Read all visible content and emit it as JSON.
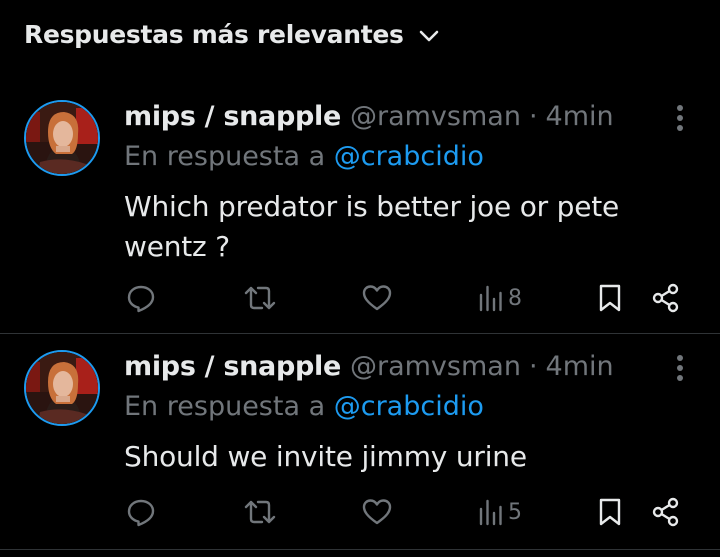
{
  "header": {
    "sort_label": "Respuestas más relevantes"
  },
  "replies": [
    {
      "display_name": "mips / snapple",
      "handle": "@ramvsman",
      "separator": "·",
      "time": "4min",
      "reply_prefix": "En respuesta a",
      "reply_to": "@crabcidio",
      "text": "Which predator is better joe or pete wentz ?",
      "views": "8"
    },
    {
      "display_name": "mips / snapple",
      "handle": "@ramvsman",
      "separator": "·",
      "time": "4min",
      "reply_prefix": "En respuesta a",
      "reply_to": "@crabcidio",
      "text": "Should we invite jimmy urine",
      "views": "5"
    }
  ],
  "icons": {
    "sort": "chevron-down-icon",
    "more": "more-vertical-icon",
    "reply": "reply-icon",
    "repost": "repost-icon",
    "like": "heart-icon",
    "views": "views-icon",
    "bookmark": "bookmark-icon",
    "share": "share-icon"
  },
  "colors": {
    "background": "#000000",
    "primary_text": "#e7e9ea",
    "secondary_text": "#71767b",
    "link": "#1d9bf0",
    "divider": "#2f3336"
  }
}
